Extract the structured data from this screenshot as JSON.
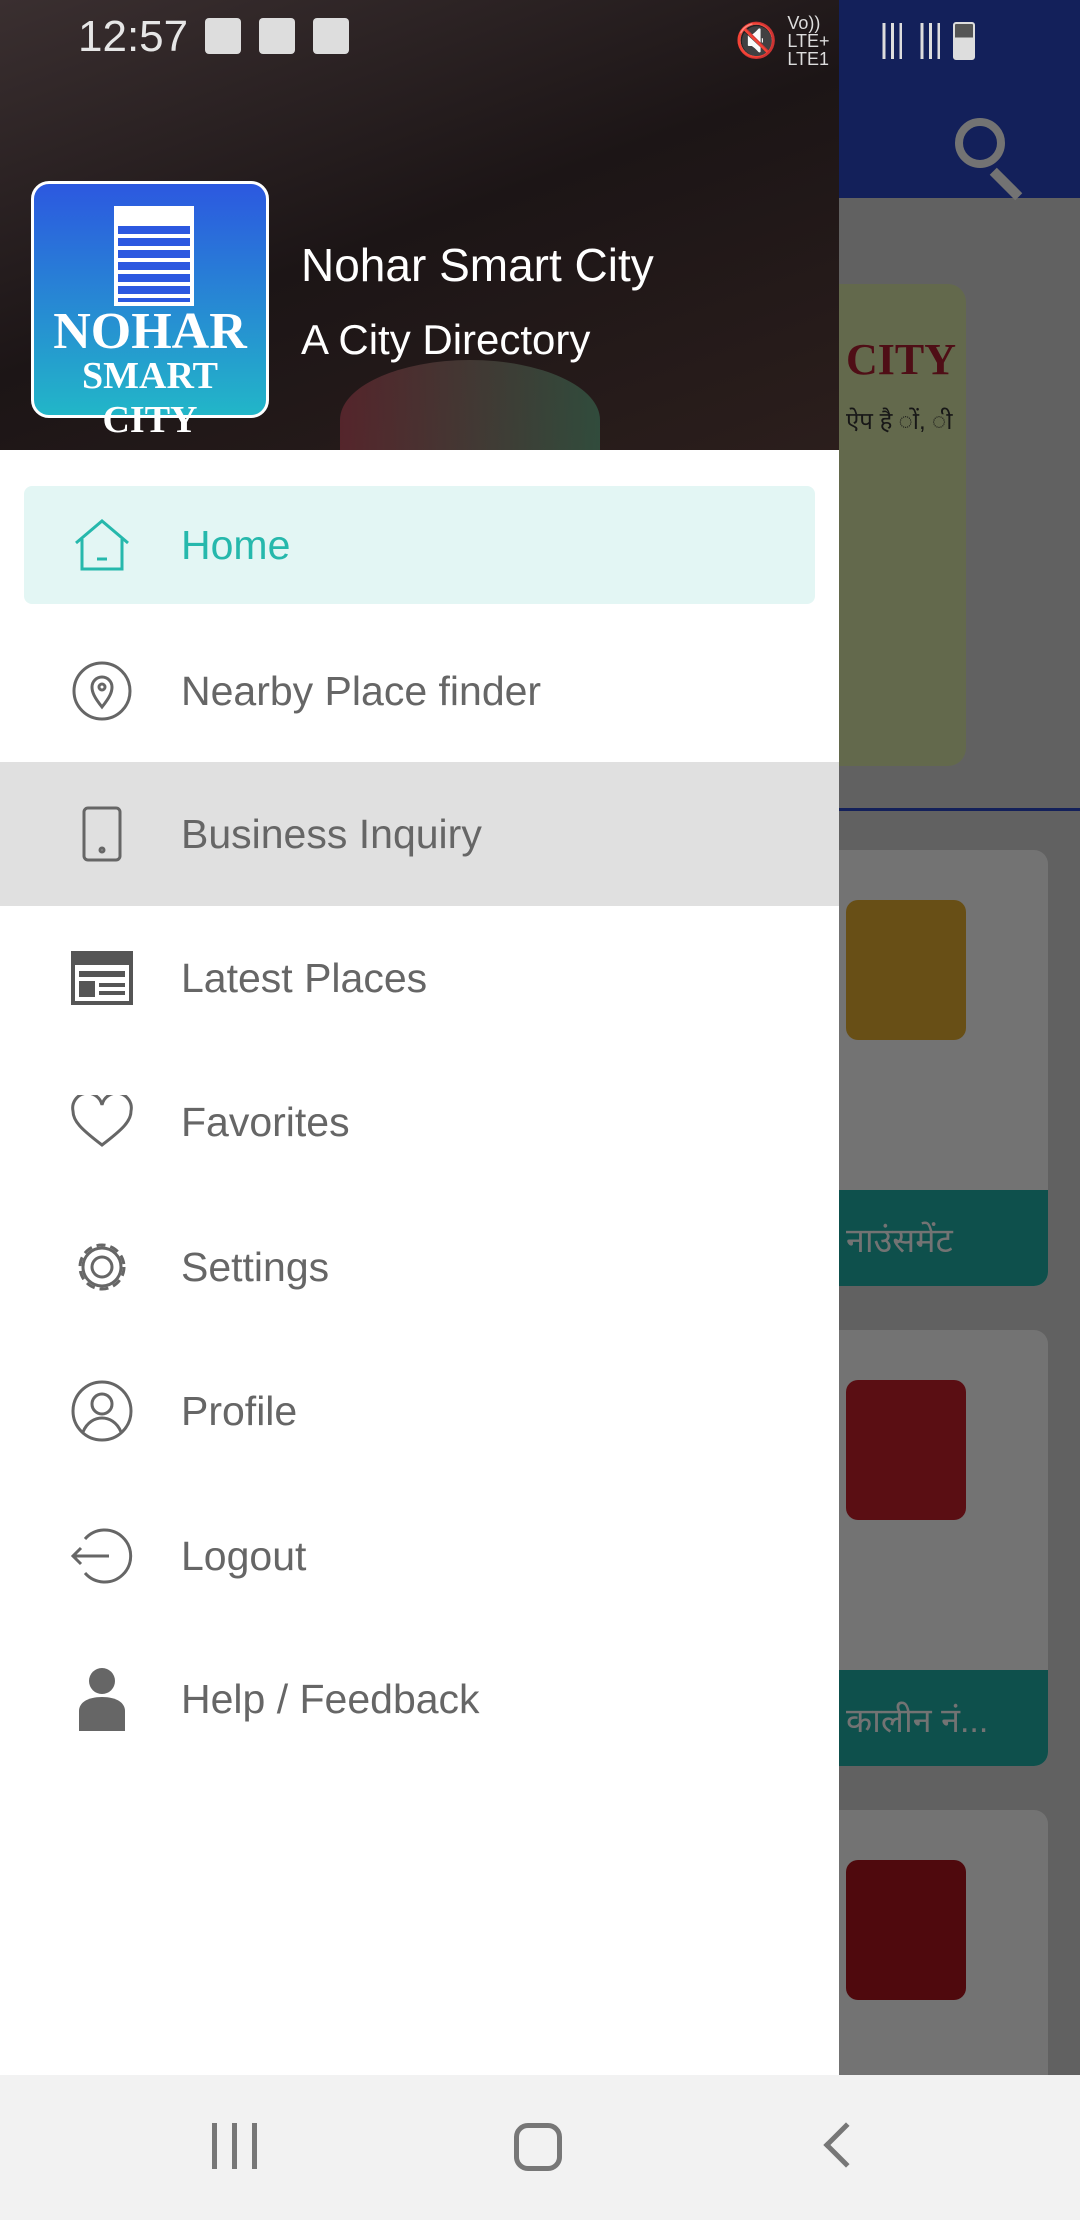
{
  "status_bar": {
    "time": "12:57",
    "network": "Vo)) LTE+ LTE1"
  },
  "header": {
    "logo_text_1": "NOHAR",
    "logo_text_2": "SMART CITY",
    "title": "Nohar Smart City",
    "subtitle": "A City Directory"
  },
  "menu": [
    {
      "label": "Home",
      "icon": "home-icon",
      "active": true
    },
    {
      "label": "Nearby Place finder",
      "icon": "location-pin-icon"
    },
    {
      "label": "Business Inquiry",
      "icon": "phone-icon",
      "pressed": true
    },
    {
      "label": "Latest Places",
      "icon": "calendar-icon"
    },
    {
      "label": "Favorites",
      "icon": "heart-icon"
    },
    {
      "label": "Settings",
      "icon": "gear-icon"
    },
    {
      "label": "Profile",
      "icon": "profile-icon"
    },
    {
      "label": "Logout",
      "icon": "logout-icon"
    },
    {
      "label": "Help / Feedback",
      "icon": "person-icon"
    }
  ],
  "background": {
    "banner_title": "CITY",
    "banner_text": "ऐप है ों, ी",
    "cards": [
      "नाउंसमेंट",
      "कालीन नं..."
    ]
  },
  "colors": {
    "accent": "#26b8ac",
    "active_bg": "#e3f6f4",
    "app_bar": "#2a48c8"
  }
}
